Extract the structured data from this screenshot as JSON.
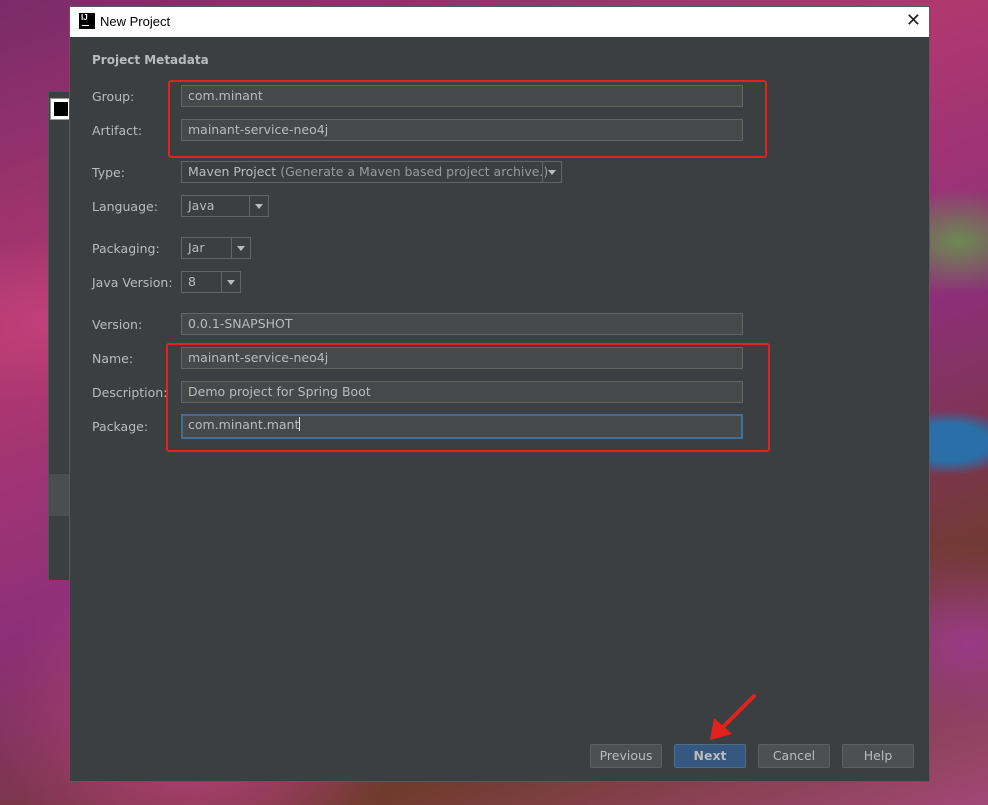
{
  "window": {
    "title": "New Project"
  },
  "section_title": "Project Metadata",
  "fields": {
    "group": {
      "label": "Group:",
      "value": "com.minant"
    },
    "artifact": {
      "label": "Artifact:",
      "value": "mainant-service-neo4j"
    },
    "type": {
      "label": "Type:",
      "value": "Maven Project",
      "hint": "(Generate a Maven based project archive.)"
    },
    "language": {
      "label": "Language:",
      "value": "Java"
    },
    "packaging": {
      "label": "Packaging:",
      "value": "Jar"
    },
    "java_version": {
      "label": "Java Version:",
      "value": "8"
    },
    "version": {
      "label": "Version:",
      "value": "0.0.1-SNAPSHOT"
    },
    "name": {
      "label": "Name:",
      "value": "mainant-service-neo4j"
    },
    "description": {
      "label": "Description:",
      "value": "Demo project for Spring Boot"
    },
    "package": {
      "label": "Package:",
      "value": "com.minant.mant"
    }
  },
  "buttons": {
    "previous": "Previous",
    "next": "Next",
    "cancel": "Cancel",
    "help": "Help"
  },
  "colors": {
    "annotation": "#e3221d",
    "dialog_bg": "#3c3f41",
    "primary_button": "#365880"
  }
}
